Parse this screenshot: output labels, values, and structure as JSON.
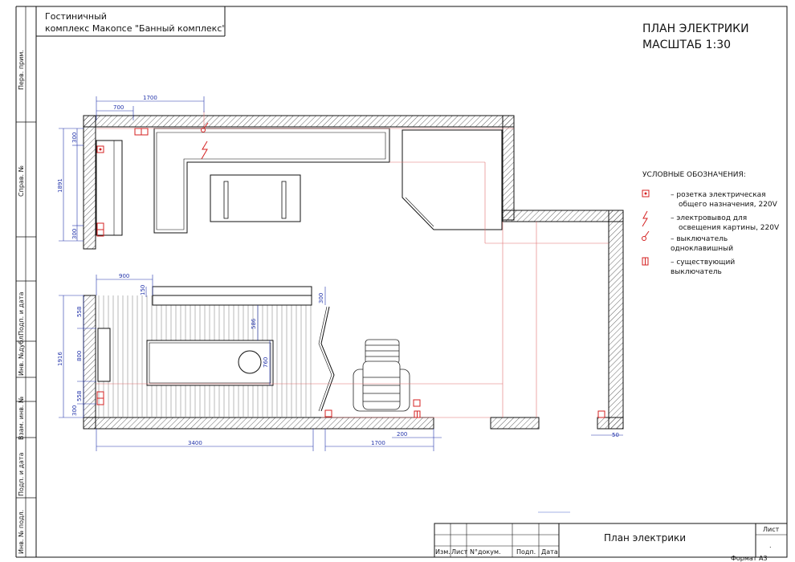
{
  "project": {
    "line1": "Гостиничный",
    "line2": "комплекс Макопсе \"Банный комплекс\""
  },
  "sheet_title": {
    "line1": "ПЛАН ЭЛЕКТРИКИ",
    "line2": "МАСШТАБ 1:30"
  },
  "side_stamp": {
    "perv_prim": "Перв. прим.",
    "sprav": "Справ. №",
    "podp_data_1": "Подп. и дата",
    "inv_dubl": "Инв. №дубл.",
    "vzam_inv": "Взам. инв. №",
    "podp_data_2": "Подп. и дата",
    "inv_podl": "Инв. № подл."
  },
  "legend": {
    "heading": "УСЛОВНЫЕ ОБОЗНАЧЕНИЯ:",
    "items": [
      {
        "icon": "socket-icon",
        "line1": "– розетка электрическая",
        "line2": "общего назначения, 220V"
      },
      {
        "icon": "lighting-outlet-icon",
        "line1": "– электровывод для",
        "line2": "освещения картины, 220V"
      },
      {
        "icon": "single-switch-icon",
        "line1": "– выключатель",
        "line2": "одноклавишный"
      },
      {
        "icon": "existing-switch-icon",
        "line1": "– существующий",
        "line2": "выключатель"
      }
    ],
    "symbol_color": "#d42020"
  },
  "dimensions": {
    "d1700_top": "1700",
    "d700": "700",
    "d300_a": "300",
    "d1891": "1891",
    "d300_b": "300",
    "d900": "900",
    "d150": "150",
    "d300_c": "300",
    "d558_a": "558",
    "d586": "586",
    "d1916": "1916",
    "d800": "800",
    "d760": "760",
    "d558_b": "558",
    "d300_d": "300",
    "d3400": "3400",
    "d1700_bottom": "1700",
    "d200": "200",
    "d50": "50"
  },
  "title_block": {
    "col_izm": "Изм.",
    "col_list": "Лист",
    "col_ndokum": "N°докум.",
    "col_podp": "Подп.",
    "col_data": "Дата",
    "drawing_name": "План электрики",
    "list_label": "Лист",
    "format": "Формат А3",
    "sheet_dot": "."
  },
  "colors": {
    "line": "#111111",
    "dimension": "#2233aa",
    "electric": "#d42020",
    "guide": "#e07070"
  }
}
